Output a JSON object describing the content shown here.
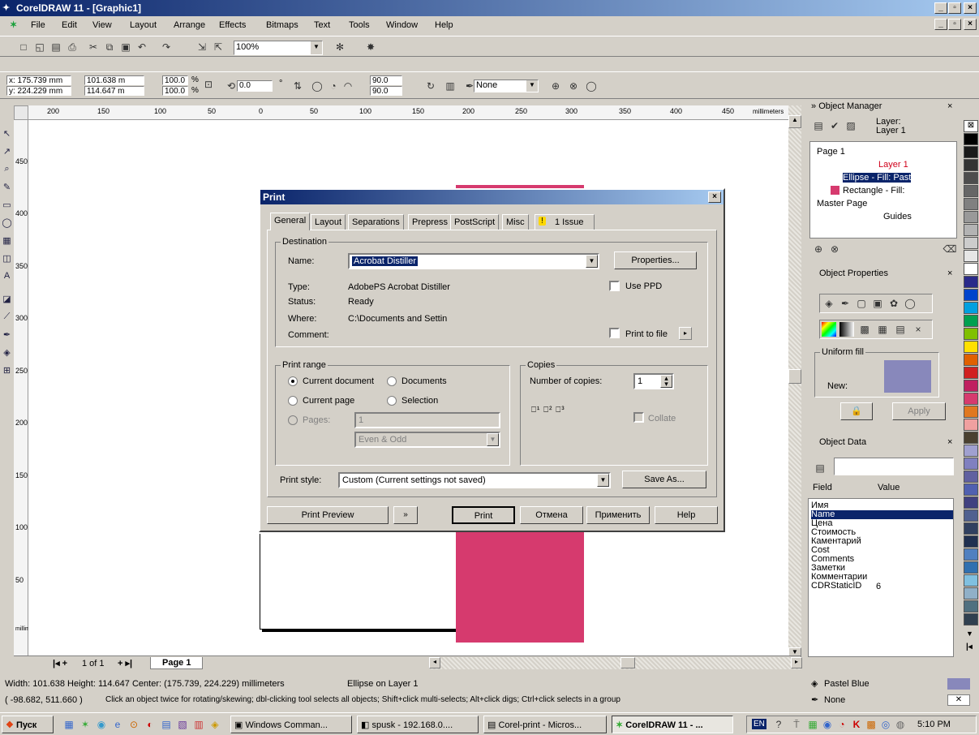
{
  "window": {
    "title": "CorelDRAW 11 - [Graphic1]"
  },
  "menus": [
    "File",
    "Edit",
    "View",
    "Layout",
    "Arrange",
    "Effects",
    "Bitmaps",
    "Text",
    "Tools",
    "Window",
    "Help"
  ],
  "toolbar": {
    "zoom": "100%"
  },
  "propbar": {
    "x": "x: 175.739 mm",
    "y": "y: 224.229 mm",
    "w": "101.638 m",
    "h": "114.647 m",
    "sx": "100.0",
    "sy": "100.0",
    "pct1": "%",
    "pct2": "%",
    "rot": "0.0",
    "deg": "°",
    "a1": "90.0",
    "a2": "90.0",
    "outline": "None"
  },
  "ruler": {
    "h_ticks": [
      "200",
      "150",
      "100",
      "50",
      "0",
      "50",
      "100",
      "150",
      "200",
      "250",
      "300",
      "350",
      "400",
      "450"
    ],
    "h_unit": "millimeters",
    "v_ticks": [
      "450",
      "400",
      "350",
      "300",
      "250",
      "200",
      "150",
      "100",
      "50"
    ],
    "v_unit": "millimeters"
  },
  "pagenav": {
    "pages": "1 of 1",
    "tab": "Page 1"
  },
  "dialog": {
    "title": "Print",
    "tabs": [
      "General",
      "Layout",
      "Separations",
      "Prepress",
      "PostScript",
      "Misc",
      "1 Issue"
    ],
    "destination": {
      "legend": "Destination",
      "name_label": "Name:",
      "name_value": "Acrobat Distiller",
      "properties": "Properties...",
      "type_label": "Type:",
      "type_value": "AdobePS Acrobat Distiller",
      "status_label": "Status:",
      "status_value": "Ready",
      "where_label": "Where:",
      "where_value": "C:\\Documents and Settin",
      "comment_label": "Comment:",
      "use_ppd": "Use PPD",
      "print_to_file": "Print to file"
    },
    "range": {
      "legend": "Print range",
      "current_doc": "Current document",
      "documents": "Documents",
      "current_page": "Current page",
      "selection": "Selection",
      "pages": "Pages:",
      "pages_value": "1",
      "even_odd": "Even & Odd"
    },
    "copies": {
      "legend": "Copies",
      "num_label": "Number of copies:",
      "num_value": "1",
      "collate": "Collate"
    },
    "style": {
      "label": "Print style:",
      "value": "Custom (Current settings not saved)",
      "save_as": "Save As..."
    },
    "buttons": {
      "preview": "Print Preview",
      "print": "Print",
      "cancel": "Отмена",
      "apply": "Применить",
      "help": "Help"
    }
  },
  "docker": {
    "obj_manager": {
      "title": "Object Manager",
      "layer_label": "Layer:",
      "layer_name": "Layer 1",
      "tree": [
        "Page 1",
        "Layer 1",
        "Ellipse - Fill: Past",
        "Rectangle - Fill:",
        "Master Page",
        "Guides"
      ]
    },
    "obj_props": {
      "title": "Object Properties",
      "uniform_fill": "Uniform fill",
      "new_label": "New:",
      "apply": "Apply"
    },
    "obj_data": {
      "title": "Object Data",
      "field_col": "Field",
      "value_col": "Value",
      "rows": [
        "Имя",
        "Name",
        "Цена",
        "Стоимость",
        "Каментарий",
        "Cost",
        "Comments",
        "Заметки",
        "Комментарии",
        "CDRStaticID"
      ],
      "static_value": "6"
    }
  },
  "status": {
    "line1": "Width: 101.638  Height: 114.647  Center: (175.739, 224.229)  millimeters",
    "obj": "Ellipse on Layer 1",
    "line2a": "( -98.682, 511.660 )",
    "line2b": "Click an object twice for rotating/skewing; dbl-clicking tool selects all objects; Shift+click multi-selects; Alt+click digs; Ctrl+click selects in a group",
    "fill": "Pastel Blue",
    "outline": "None"
  },
  "taskbar": {
    "start": "Пуск",
    "tasks": [
      "Windows Comman...",
      "spusk - 192.168.0....",
      "Corel-print - Micros...",
      "CorelDRAW 11 - ..."
    ],
    "lang": "EN",
    "clock": "5:10 PM"
  },
  "colors": {
    "pink": "#d63a6e",
    "pastel_blue": "#8888bb"
  }
}
